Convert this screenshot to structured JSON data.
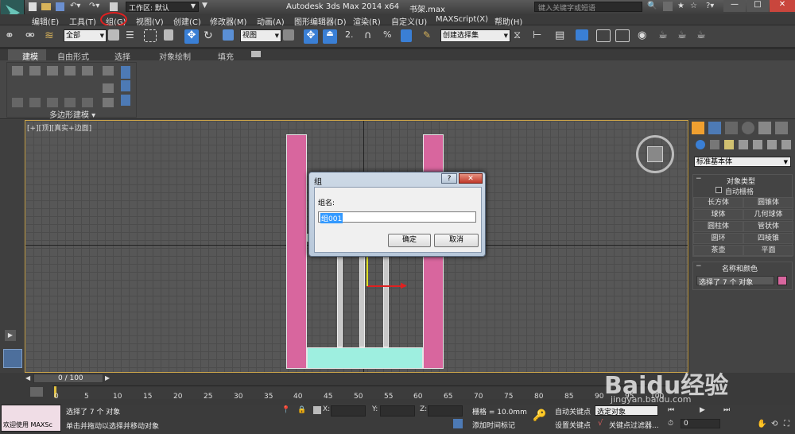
{
  "title": {
    "workspace": "工作区: 默认",
    "app": "Autodesk 3ds Max  2014 x64",
    "file": "书架.max",
    "search_placeholder": "键入关键字或短语"
  },
  "menu": [
    "编辑(E)",
    "工具(T)",
    "组(G)",
    "视图(V)",
    "创建(C)",
    "修改器(M)",
    "动画(A)",
    "图形编辑器(D)",
    "渲染(R)",
    "自定义(U)",
    "MAXScript(X)",
    "帮助(H)"
  ],
  "toolbar": {
    "selection_filter": "全部",
    "ref_coord": "视图",
    "named_selection": "创建选择集",
    "snap_label": "2.",
    "percent_label": "%"
  },
  "ribbon": {
    "tabs": [
      "建模",
      "自由形式",
      "选择",
      "对象绘制",
      "填充"
    ],
    "panel_label": "多边形建模 ▾"
  },
  "viewport": {
    "label": "[+][顶][真实+边面]"
  },
  "dialog": {
    "title": "组",
    "field_label": "组名:",
    "field_value": "组001",
    "ok": "确定",
    "cancel": "取消",
    "help": "?",
    "close": "✕"
  },
  "cmdpanel": {
    "category": "标准基本体",
    "object_type_title": "对象类型",
    "autogrid": "自动栅格",
    "buttons": [
      "长方体",
      "圆锥体",
      "球体",
      "几何球体",
      "圆柱体",
      "管状体",
      "圆环",
      "四棱锥",
      "茶壶",
      "平面"
    ],
    "name_color_title": "名称和颜色",
    "name_value": "选择了 7 个 对象",
    "name_color_value": "#d8669e"
  },
  "timeline": {
    "frame": "0 / 100",
    "ticks": [
      "0",
      "5",
      "10",
      "15",
      "20",
      "25",
      "30",
      "35",
      "40",
      "45",
      "50",
      "55",
      "60",
      "65",
      "70",
      "75",
      "80",
      "85",
      "90",
      "95",
      "100"
    ]
  },
  "status": {
    "welcome": "欢迎使用 MAXSc",
    "selected": "选择了 7 个 对象",
    "prompt": "单击并拖动以选择并移动对象",
    "x_label": "X:",
    "y_label": "Y:",
    "z_label": "Z:",
    "grid": "栅格 = 10.0mm",
    "add_time_tag": "添加时间标记",
    "auto_key": "自动关键点",
    "set_key": "设置关键点",
    "selected_obj": "选定对象",
    "key_filters": "关键点过滤器...",
    "frame_value": "0"
  },
  "watermark": "Baidu经验",
  "watermark_url": "jingyan.baidu.com",
  "colors": {
    "pink": "#d8669e",
    "cyan": "#9eefe0",
    "highlight": "#e02020"
  }
}
